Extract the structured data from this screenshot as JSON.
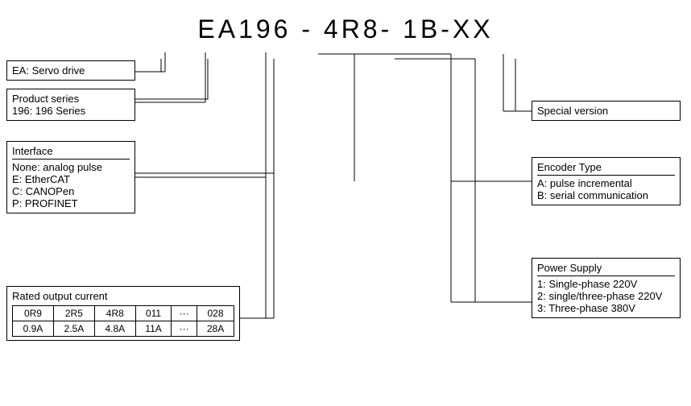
{
  "title": "EA196   -   4R8-  1B-XX",
  "boxes": {
    "ea": {
      "label": "EA: Servo drive"
    },
    "product": {
      "line1": "Product series",
      "line2": "196: 196 Series"
    },
    "interface": {
      "header": "Interface",
      "items": [
        "None: analog pulse",
        "E: EtherCAT",
        "C: CANOPen",
        "P: PROFINET"
      ]
    },
    "rated": {
      "header": "Rated output current",
      "cols": [
        "0R9",
        "2R5",
        "4R8",
        "011",
        "···",
        "028"
      ],
      "vals": [
        "0.9A",
        "2.5A",
        "4.8A",
        "11A",
        "···",
        "28A"
      ]
    },
    "special": {
      "label": "Special version"
    },
    "encoder": {
      "header": "Encoder Type",
      "items": [
        "A: pulse incremental",
        "B: serial communication"
      ]
    },
    "power": {
      "header": "Power Supply",
      "items": [
        "1: Single-phase 220V",
        "2: single/three-phase 220V",
        "3: Three-phase 380V"
      ]
    }
  }
}
